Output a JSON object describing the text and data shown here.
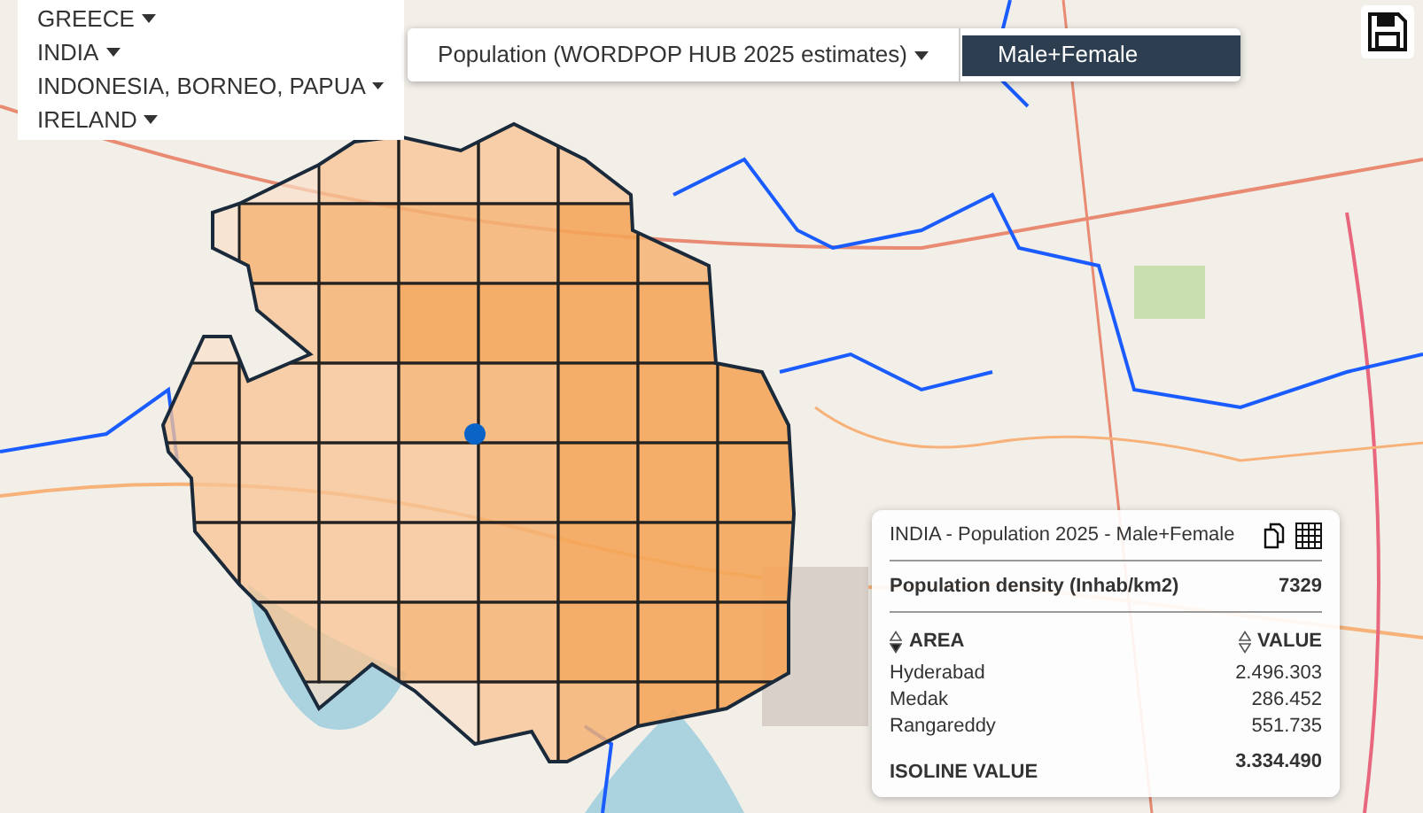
{
  "countries": [
    {
      "label": "GREECE"
    },
    {
      "label": "INDIA"
    },
    {
      "label": "INDONESIA, BORNEO, PAPUA"
    },
    {
      "label": "IRELAND"
    }
  ],
  "layer_dropdown": {
    "label": "Population (WORDPOP HUB 2025 estimates)"
  },
  "gender_options": [
    {
      "label": "Male+Female",
      "selected": true
    }
  ],
  "info_panel": {
    "title": "INDIA - Population 2025 - Male+Female",
    "density": {
      "label": "Population density (Inhab/km2)",
      "value": "7329"
    },
    "columns": [
      {
        "label": "AREA",
        "sorted": true
      },
      {
        "label": "VALUE",
        "sorted": false
      }
    ],
    "rows": [
      {
        "area": "Hyderabad",
        "value": "2.496.303"
      },
      {
        "area": "Medak",
        "value": "286.452"
      },
      {
        "area": "Rangareddy",
        "value": "551.735"
      }
    ],
    "total": {
      "label": "ISOLINE VALUE",
      "value": "3.334.490"
    }
  }
}
